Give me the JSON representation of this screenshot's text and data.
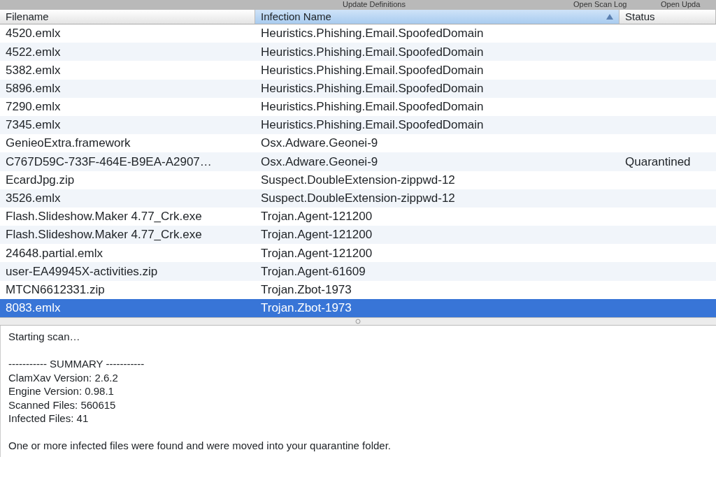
{
  "toolbar": {
    "buttons": [
      "Update Definitions",
      "Open Scan Log",
      "Open Upda"
    ]
  },
  "table": {
    "columns": [
      {
        "label": "Filename",
        "sorted": false
      },
      {
        "label": "Infection Name",
        "sorted": true
      },
      {
        "label": "Status",
        "sorted": false
      }
    ],
    "rows": [
      {
        "filename": "4520.emlx",
        "infection": "Heuristics.Phishing.Email.SpoofedDomain",
        "selected": false
      },
      {
        "filename": "4522.emlx",
        "infection": "Heuristics.Phishing.Email.SpoofedDomain",
        "selected": false
      },
      {
        "filename": "5382.emlx",
        "infection": "Heuristics.Phishing.Email.SpoofedDomain",
        "selected": false
      },
      {
        "filename": "5896.emlx",
        "infection": "Heuristics.Phishing.Email.SpoofedDomain",
        "selected": false
      },
      {
        "filename": "7290.emlx",
        "infection": "Heuristics.Phishing.Email.SpoofedDomain",
        "selected": false
      },
      {
        "filename": "7345.emlx",
        "infection": "Heuristics.Phishing.Email.SpoofedDomain",
        "selected": false
      },
      {
        "filename": "GenieoExtra.framework",
        "infection": "Osx.Adware.Geonei-9",
        "selected": false
      },
      {
        "filename": "C767D59C-733F-464E-B9EA-A2907…",
        "infection": "Osx.Adware.Geonei-9",
        "status": "Quarantined",
        "selected": false
      },
      {
        "filename": "EcardJpg.zip",
        "infection": "Suspect.DoubleExtension-zippwd-12",
        "selected": false
      },
      {
        "filename": "3526.emlx",
        "infection": "Suspect.DoubleExtension-zippwd-12",
        "selected": false
      },
      {
        "filename": "Flash.Slideshow.Maker 4.77_Crk.exe",
        "infection": "Trojan.Agent-121200",
        "selected": false
      },
      {
        "filename": "Flash.Slideshow.Maker 4.77_Crk.exe",
        "infection": "Trojan.Agent-121200",
        "selected": false
      },
      {
        "filename": "24648.partial.emlx",
        "infection": "Trojan.Agent-121200",
        "selected": false
      },
      {
        "filename": "user-EA49945X-activities.zip",
        "infection": "Trojan.Agent-61609",
        "selected": false
      },
      {
        "filename": "MTCN6612331.zip",
        "infection": "Trojan.Zbot-1973",
        "selected": false
      },
      {
        "filename": "8083.emlx",
        "infection": "Trojan.Zbot-1973",
        "selected": true
      }
    ]
  },
  "log": {
    "paragraphs": [
      [
        "Starting scan…"
      ],
      [
        "----------- SUMMARY -----------",
        "ClamXav Version: 2.6.2",
        "Engine Version: 0.98.1",
        "Scanned Files: 560615",
        "Infected Files: 41"
      ],
      [
        "One or more infected files were found and were moved into your quarantine folder."
      ]
    ]
  }
}
